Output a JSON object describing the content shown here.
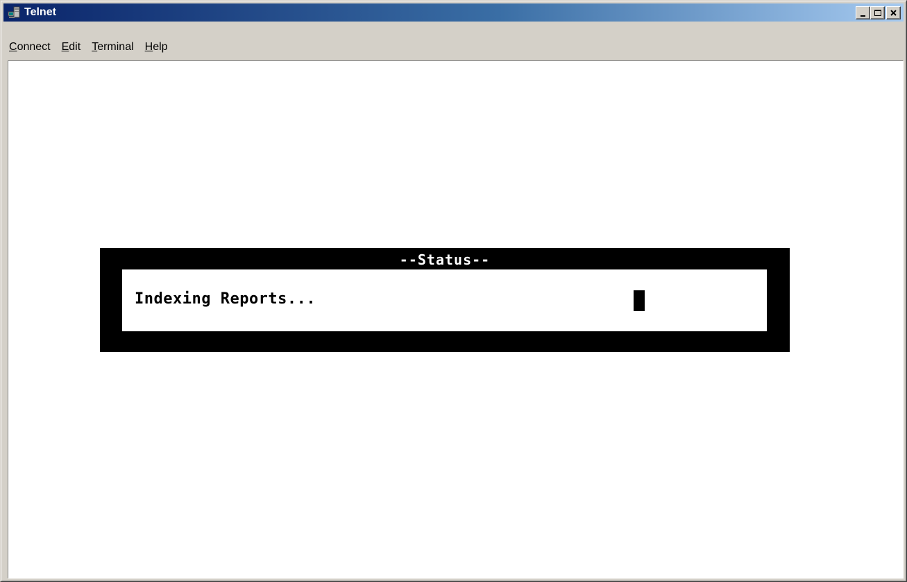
{
  "window": {
    "title": "Telnet",
    "icon": "telnet-computer-icon",
    "controls": [
      "minimize-icon",
      "maximize-icon",
      "close-icon"
    ]
  },
  "menu": [
    {
      "label": "Connect",
      "mnemonic": "C",
      "rest": "onnect"
    },
    {
      "label": "Edit",
      "mnemonic": "E",
      "rest": "dit"
    },
    {
      "label": "Terminal",
      "mnemonic": "T",
      "rest": "erminal"
    },
    {
      "label": "Help",
      "mnemonic": "H",
      "rest": "elp"
    }
  ],
  "terminal": {
    "status_title": "--Status--",
    "status_message": "Indexing Reports...",
    "background": "#ffffff",
    "foreground": "#000000"
  },
  "colors": {
    "titlebar_start": "#0a246a",
    "titlebar_end": "#a6caf0",
    "chrome": "#d4d0c8"
  }
}
